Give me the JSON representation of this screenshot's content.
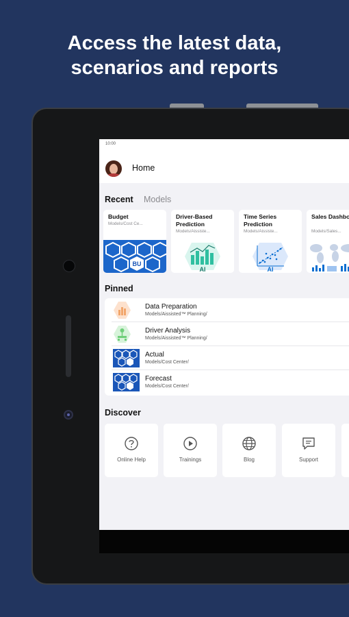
{
  "promo": {
    "line1": "Access the latest data,",
    "line2": "scenarios and reports"
  },
  "statusbar": {
    "time": "10:00"
  },
  "header": {
    "title": "Home"
  },
  "tabs": [
    {
      "label": "Recent",
      "active": true
    },
    {
      "label": "Models",
      "active": false
    }
  ],
  "recent": [
    {
      "title": "Budget",
      "path": "Models/Cost Ce...",
      "thumb": "budget-hexagon-thumbnail",
      "thumb_text": "BU"
    },
    {
      "title": "Driver-Based Prediction",
      "path": "Models/Aissiste...",
      "thumb": "ai-bar-chart-thumbnail",
      "thumb_text": "AI"
    },
    {
      "title": "Time Series Prediction",
      "path": "Models/Aissiste...",
      "thumb": "ai-scatter-chart-thumbnail",
      "thumb_text": "AI"
    },
    {
      "title": "Sales Dashboard",
      "path": "Models/Sales...",
      "thumb": "world-map-dashboard-thumbnail",
      "thumb_text": ""
    }
  ],
  "pinned": {
    "title": "Pinned",
    "items": [
      {
        "title": "Data Preparation",
        "path": "Models/Aissisted™ Planning/",
        "icon": "data-preparation-icon"
      },
      {
        "title": "Driver Analysis",
        "path": "Models/Aissisted™ Planning/",
        "icon": "driver-analysis-icon"
      },
      {
        "title": "Actual",
        "path": "Models/Cost Center/",
        "icon": "actual-model-icon"
      },
      {
        "title": "Forecast",
        "path": "Models/Cost Center/",
        "icon": "forecast-model-icon"
      }
    ]
  },
  "discover": {
    "title": "Discover",
    "items": [
      {
        "label": "Online Help",
        "icon": "question-circle-icon"
      },
      {
        "label": "Trainings",
        "icon": "play-circle-icon"
      },
      {
        "label": "Blog",
        "icon": "globe-icon"
      },
      {
        "label": "Support",
        "icon": "message-icon"
      }
    ]
  },
  "colors": {
    "background": "#22355f",
    "screen_background": "#f2f2f6",
    "accent_blue": "#0a6ed1",
    "orange": "#f2a66b",
    "green": "#6fcf7a",
    "teal": "#2fbfa0"
  }
}
